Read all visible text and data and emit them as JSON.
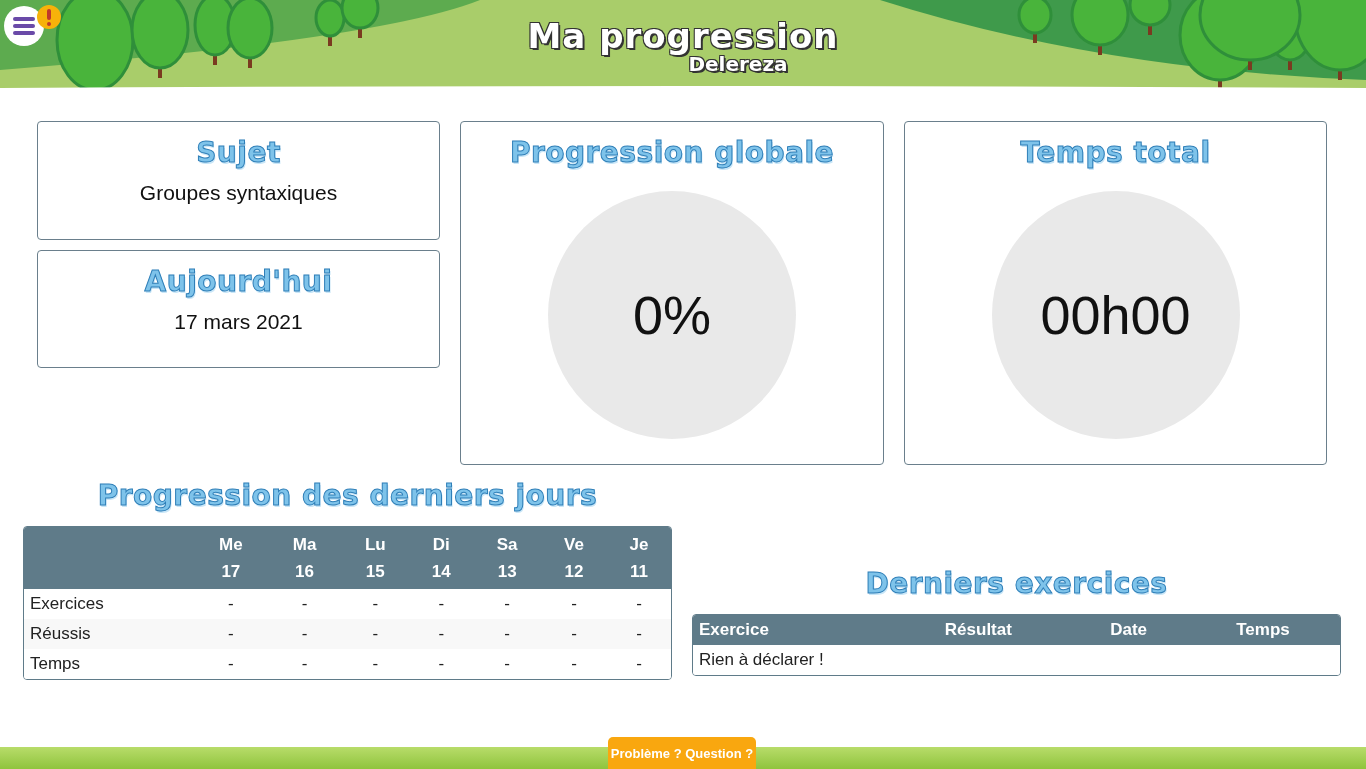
{
  "header": {
    "title": "Ma progression",
    "subtitle": "Delereza",
    "alert": true
  },
  "cards": {
    "subject": {
      "title": "Sujet",
      "value": "Groupes syntaxiques"
    },
    "today": {
      "title": "Aujourd'hui",
      "value": "17 mars 2021"
    },
    "progress": {
      "title": "Progression globale",
      "value": "0%"
    },
    "time": {
      "title": "Temps total",
      "value": "00h00"
    }
  },
  "recent_days": {
    "title": "Progression des derniers jours",
    "columns": [
      {
        "day": "Me",
        "date": "17"
      },
      {
        "day": "Ma",
        "date": "16"
      },
      {
        "day": "Lu",
        "date": "15"
      },
      {
        "day": "Di",
        "date": "14"
      },
      {
        "day": "Sa",
        "date": "13"
      },
      {
        "day": "Ve",
        "date": "12"
      },
      {
        "day": "Je",
        "date": "11"
      }
    ],
    "rows": [
      {
        "label": "Exercices",
        "values": [
          "-",
          "-",
          "-",
          "-",
          "-",
          "-",
          "-"
        ]
      },
      {
        "label": "Réussis",
        "values": [
          "-",
          "-",
          "-",
          "-",
          "-",
          "-",
          "-"
        ]
      },
      {
        "label": "Temps",
        "values": [
          "-",
          "-",
          "-",
          "-",
          "-",
          "-",
          "-"
        ]
      }
    ]
  },
  "last_exercises": {
    "title": "Derniers exercices",
    "columns": [
      "Exercice",
      "Résultat",
      "Date",
      "Temps"
    ],
    "empty_message": "Rien à déclarer !"
  },
  "footer_button": "Problème ? Question ?"
}
